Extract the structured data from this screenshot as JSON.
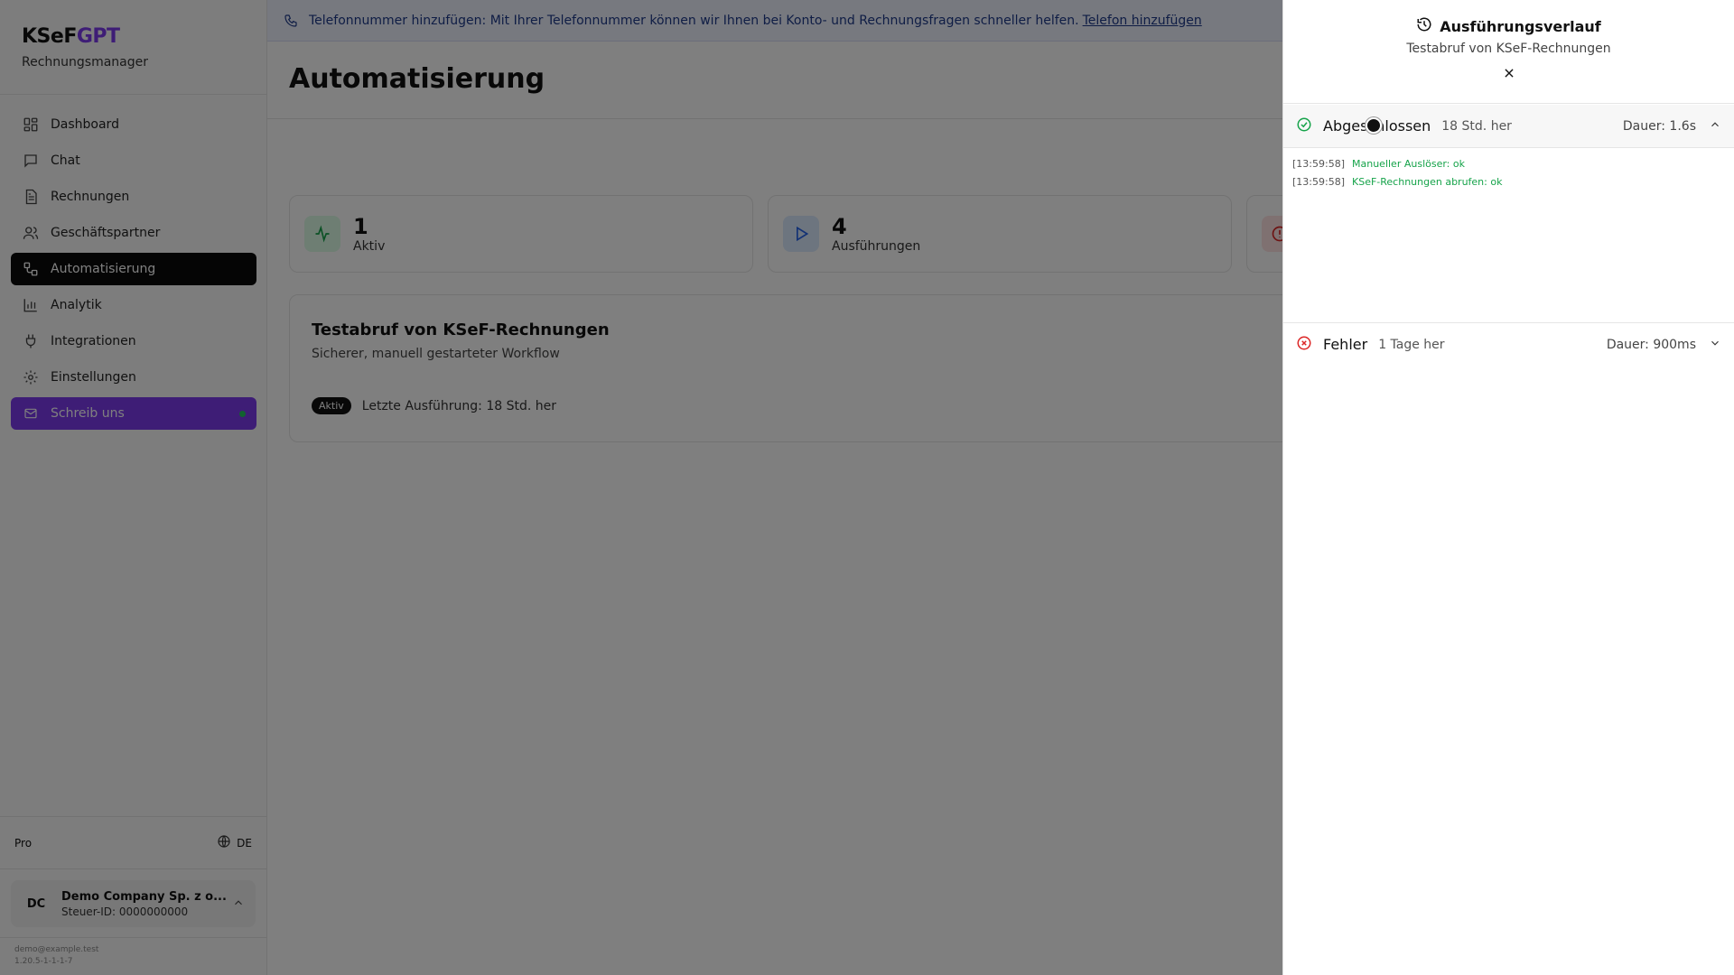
{
  "app": {
    "logo_prefix": "KSeF",
    "logo_suffix": "GPT",
    "subtitle": "Rechnungsmanager"
  },
  "sidebar": {
    "items": [
      {
        "label": "Dashboard",
        "icon": "dashboard-icon"
      },
      {
        "label": "Chat",
        "icon": "chat-icon"
      },
      {
        "label": "Rechnungen",
        "icon": "invoice-icon"
      },
      {
        "label": "Geschäftspartner",
        "icon": "users-icon"
      },
      {
        "label": "Automatisierung",
        "icon": "workflow-icon",
        "active": true
      },
      {
        "label": "Analytik",
        "icon": "bar-chart-icon"
      },
      {
        "label": "Integrationen",
        "icon": "plug-icon"
      },
      {
        "label": "Einstellungen",
        "icon": "gear-icon"
      }
    ],
    "contact_label": "Schreib uns",
    "plan": "Pro",
    "language": "DE",
    "company": {
      "initials": "DC",
      "name": "Demo Company Sp. z o...",
      "tax_id": "Steuer-ID: 0000000000"
    },
    "footer_email": "demo@example.test",
    "footer_version": "1.20.5-1-1-1-7"
  },
  "banner": {
    "text": "Telefonnummer hinzufügen: Mit Ihrer Telefonnummer können wir Ihnen bei Konto- und Rechnungsfragen schneller helfen.",
    "link": "Telefon hinzufügen"
  },
  "main": {
    "title": "Automatisierung",
    "stats": [
      {
        "value": "1",
        "label": "Aktiv"
      },
      {
        "value": "4",
        "label": "Ausführungen"
      }
    ],
    "workflow": {
      "title": "Testabruf von KSeF-Rechnungen",
      "description": "Sicherer, manuell gestarteter Workflow",
      "status": "Aktiv",
      "last_run": "Letzte Ausführung: 18 Std. her"
    }
  },
  "panel": {
    "title": "Ausführungsverlauf",
    "subtitle": "Testabruf von KSeF-Rechnungen",
    "runs": [
      {
        "status": "Abgeschlossen",
        "ago": "18 Std. her",
        "duration": "Dauer: 1.6s",
        "logs": [
          {
            "time": "[13:59:58]",
            "message": "Manueller Auslöser: ok"
          },
          {
            "time": "[13:59:58]",
            "message": "KSeF-Rechnungen abrufen: ok"
          }
        ]
      },
      {
        "status": "Fehler",
        "ago": "1 Tage her",
        "duration": "Dauer: 900ms"
      }
    ]
  },
  "colors": {
    "brand": "#7c3aed",
    "success": "#16a34a",
    "error": "#dc2626",
    "active_nav": "#0a0a0a"
  }
}
